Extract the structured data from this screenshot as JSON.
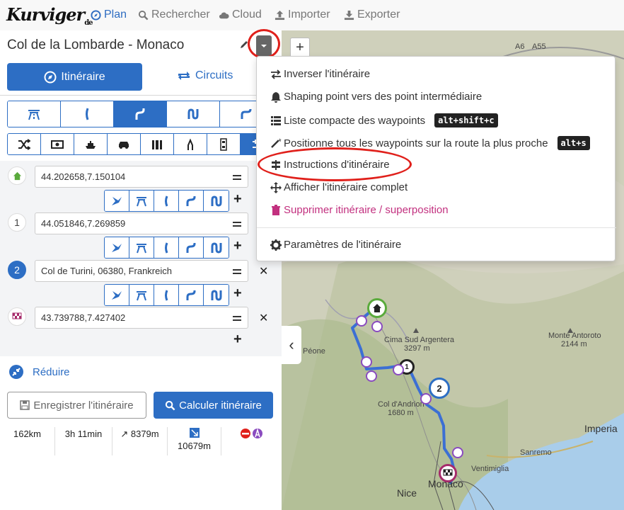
{
  "app": {
    "logo": "Kurviger",
    "logo_suffix": "de"
  },
  "nav": {
    "plan": "Plan",
    "search": "Rechercher",
    "cloud": "Cloud",
    "import": "Importer",
    "export": "Exporter"
  },
  "route": {
    "title": "Col de la Lombarde - Monaco"
  },
  "tabs": {
    "itinerary": "Itinéraire",
    "circuits": "Circuits"
  },
  "waypoints": [
    {
      "marker": "",
      "value": "44.202658,7.150104"
    },
    {
      "marker": "1",
      "value": "44.051846,7.269859"
    },
    {
      "marker": "2",
      "value": "Col de Turini, 06380, Frankreich"
    },
    {
      "marker": "",
      "value": "43.739788,7.427402"
    }
  ],
  "actions": {
    "reduce": "Réduire",
    "save": "Enregistrer l'itinéraire",
    "calculate": "Calculer itinéraire"
  },
  "stats": {
    "distance": "162km",
    "duration": "3h 11min",
    "ascent": "↗ 8379m",
    "descent": "10679m"
  },
  "menu": {
    "reverse": "Inverser l'itinéraire",
    "shaping": "Shaping point vers des point intermédiaire",
    "compact_list": "Liste compacte des waypoints",
    "compact_kbd": "alt+shift+c",
    "snap_all": "Positionne tous les waypoints sur la route la plus proche",
    "snap_kbd": "alt+s",
    "instructions": "Instructions d'itinéraire",
    "show_full": "Afficher l'itinéraire complet",
    "delete": "Supprimer itinéraire / superposition",
    "settings": "Paramètres de l'itinéraire"
  },
  "map": {
    "zoom_in": "+",
    "collapse": "‹",
    "labels": {
      "a6": "A6",
      "a55": "A55",
      "cima": "Cima Sud Argentera",
      "cima_alt": "3297 m",
      "peone": "Péone",
      "monte": "Monte Antoroto",
      "monte_alt": "2144 m",
      "andrion": "Col d'Andrion",
      "andrion_alt": "1680 m",
      "imperia": "Imperia",
      "sanremo": "Sanremo",
      "ventimiglia": "Ventimiglia",
      "nice": "Nice",
      "monaco": "Monaco"
    }
  },
  "colors": {
    "accent": "#2d6ec4",
    "danger": "#c2307f",
    "highlight": "#e0201b",
    "route": "#3b6fd4"
  }
}
